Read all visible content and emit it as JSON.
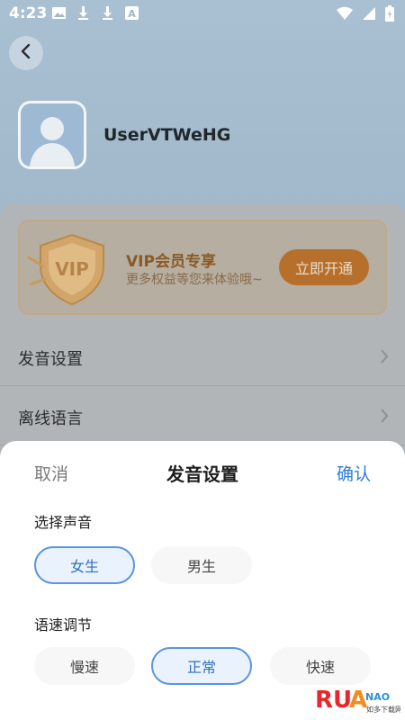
{
  "status": {
    "time": "4:23"
  },
  "profile": {
    "username": "UserVTWeHG"
  },
  "vip": {
    "title": "VIP会员专享",
    "subtitle": "更多权益等您来体验哦~",
    "button": "立即开通"
  },
  "rows": {
    "voice_settings": "发音设置",
    "offline_language": "离线语言"
  },
  "sheet": {
    "cancel": "取消",
    "title": "发音设置",
    "confirm": "确认",
    "voice_section": "选择声音",
    "voice_female": "女生",
    "voice_male": "男生",
    "speed_section": "语速调节",
    "speed_slow": "慢速",
    "speed_normal": "正常",
    "speed_fast": "快速",
    "selected_voice": "女生",
    "selected_speed": "正常"
  },
  "watermark": {
    "text": "RUANMAO",
    "sub": "如多下载网"
  },
  "colors": {
    "accent": "#2f7bd9",
    "vip_button": "#d4822e"
  }
}
